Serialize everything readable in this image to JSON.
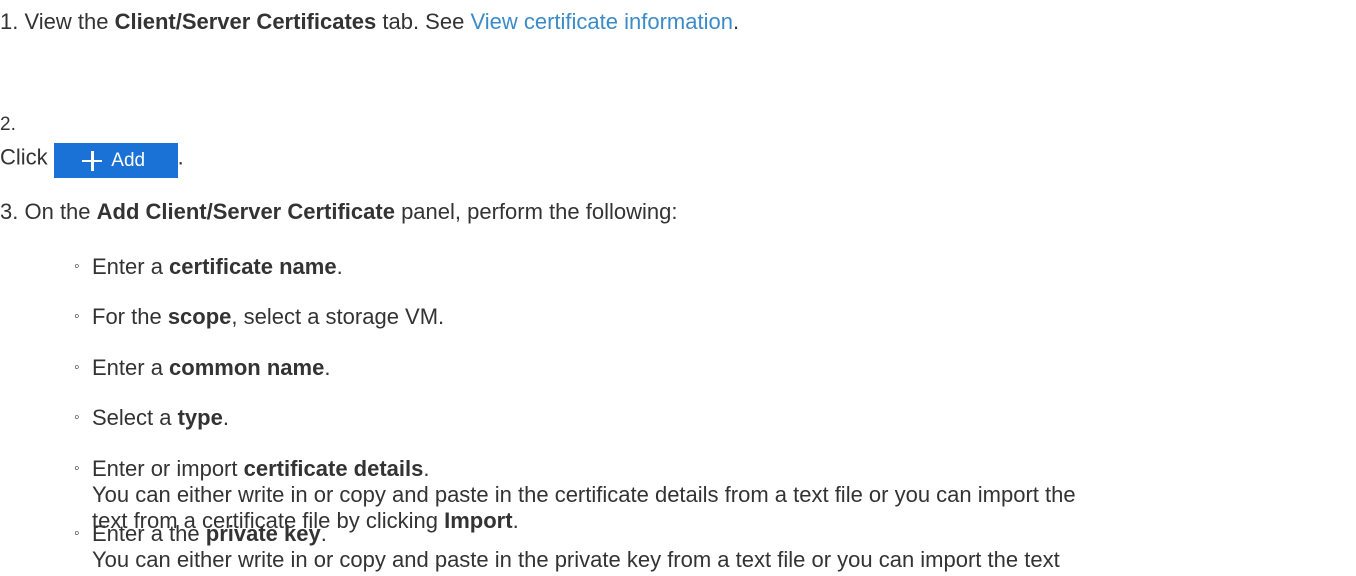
{
  "steps": [
    {
      "number": "1.",
      "parts": [
        "View the ",
        "Client/Server Certificates",
        " tab. See ",
        "View certificate information",
        "."
      ]
    },
    {
      "number": "2.",
      "text_before": "Click",
      "button_label": "Add",
      "text_after": "."
    },
    {
      "number": "3.",
      "parts": [
        "On the ",
        "Add Client/Server Certificate",
        " panel, perform the following:"
      ]
    }
  ],
  "substeps": [
    {
      "bullet": "◦",
      "parts": [
        "Enter a ",
        "certificate name",
        "."
      ]
    },
    {
      "bullet": "◦",
      "parts": [
        "For the ",
        "scope",
        ", select a storage VM."
      ]
    },
    {
      "bullet": "◦",
      "parts": [
        "Enter a ",
        "common name",
        "."
      ]
    },
    {
      "bullet": "◦",
      "parts": [
        "Select a ",
        "type",
        "."
      ]
    },
    {
      "bullet": "◦",
      "parts": [
        "Enter or import ",
        "certificate details",
        "."
      ],
      "detail_line1": "You can either write in or copy and paste in the certificate details from a text file or you can import the",
      "detail_line2_parts": [
        "text from a certificate file by clicking ",
        "Import",
        "."
      ]
    },
    {
      "bullet": "◦",
      "parts": [
        "Enter a the ",
        "private key",
        "."
      ],
      "detail_line1": "You can either write in or copy and paste in the private key from a text file or you can import the text"
    }
  ],
  "colors": {
    "text": "#333333",
    "link": "#3c8bc9",
    "button_bg": "#1a72d6",
    "button_text": "#ffffff"
  },
  "icons": {
    "add_button_icon": "plus-icon"
  }
}
